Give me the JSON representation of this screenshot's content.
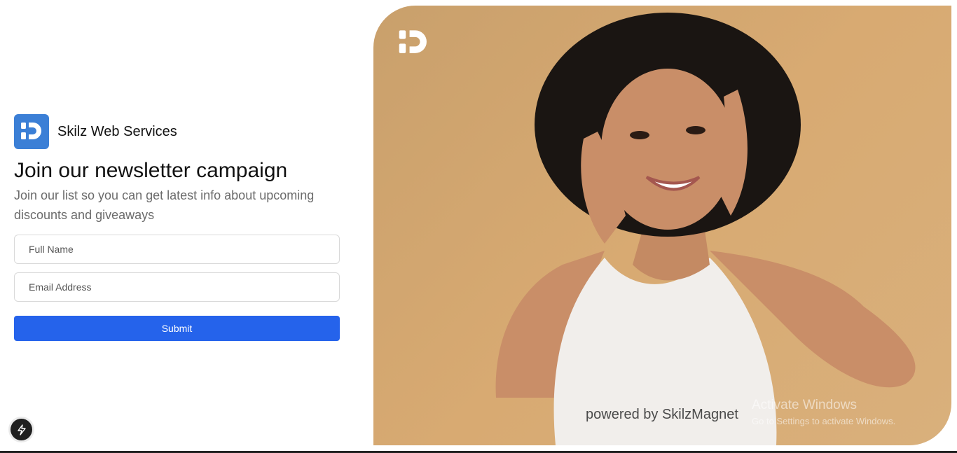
{
  "brand": {
    "name": "Skilz Web Services",
    "logo_icon": "skilz-logo-icon",
    "logo_color": "#3b7fd6"
  },
  "headline": "Join our newsletter campaign",
  "subtext": "Join our list so you can get latest info about upcoming discounts and giveaways",
  "form": {
    "full_name": {
      "placeholder": "Full Name",
      "value": ""
    },
    "email": {
      "placeholder": "Email Address",
      "value": ""
    },
    "submit_label": "Submit",
    "submit_color": "#2563eb"
  },
  "hero": {
    "background": "#d4a770",
    "logo_icon": "skilz-logo-icon",
    "powered_by": "powered by SkilzMagnet"
  },
  "os_watermark": {
    "title": "Activate Windows",
    "subtitle": "Go to Settings to activate Windows."
  },
  "dev_tools": {
    "icon": "lightning-icon"
  }
}
